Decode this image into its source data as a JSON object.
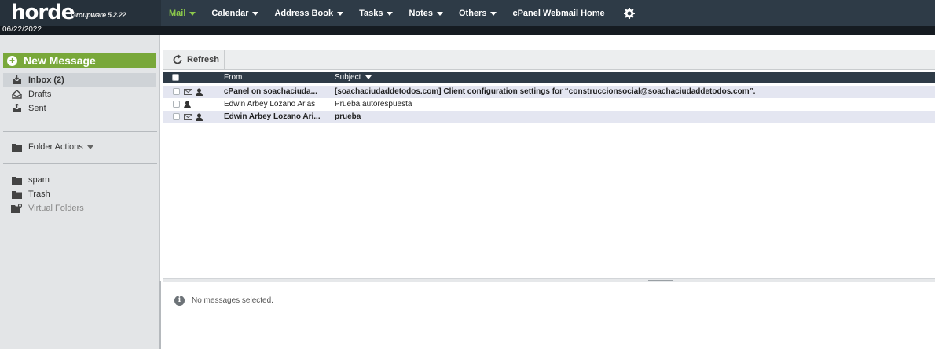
{
  "app": {
    "logo_word": "horde",
    "logo_sub": "Groupware 5.2.22",
    "date": "06/22/2022"
  },
  "menu": [
    {
      "label": "Mail",
      "dropdown": true,
      "active": true
    },
    {
      "label": "Calendar",
      "dropdown": true
    },
    {
      "label": "Address Book",
      "dropdown": true
    },
    {
      "label": "Tasks",
      "dropdown": true
    },
    {
      "label": "Notes",
      "dropdown": true
    },
    {
      "label": "Others",
      "dropdown": true
    },
    {
      "label": "cPanel Webmail Home",
      "dropdown": false
    }
  ],
  "sidebar": {
    "new_message": "New Message",
    "folders": [
      {
        "label": "Inbox (2)",
        "icon": "inbox-icon",
        "selected": true
      },
      {
        "label": "Drafts",
        "icon": "drafts-icon"
      },
      {
        "label": "Sent",
        "icon": "sent-icon"
      }
    ],
    "folder_actions": "Folder Actions",
    "other_folders": [
      {
        "label": "spam",
        "icon": "folder-icon"
      },
      {
        "label": "Trash",
        "icon": "folder-icon"
      },
      {
        "label": "Virtual Folders",
        "icon": "virtual-folder-icon"
      }
    ]
  },
  "toolbar": {
    "refresh": "Refresh"
  },
  "list": {
    "headers": {
      "from": "From",
      "subject": "Subject"
    },
    "rows": [
      {
        "from": "cPanel on soachaciuda...",
        "subject": "[soachaciudaddetodos.com] Client configuration settings for “construccionsocial@soachaciudaddetodos.com”.",
        "unread": true,
        "envelope": true
      },
      {
        "from": "Edwin Arbey Lozano Arias",
        "subject": "Prueba autorespuesta",
        "unread": false,
        "envelope": false
      },
      {
        "from": "Edwin Arbey Lozano Ari...",
        "subject": "prueba",
        "unread": true,
        "envelope": true
      }
    ]
  },
  "preview": {
    "empty_text": "No messages selected."
  },
  "colors": {
    "accent": "#79a83a",
    "topbar": "#2e3b47",
    "menu_active": "#8cc84b"
  }
}
